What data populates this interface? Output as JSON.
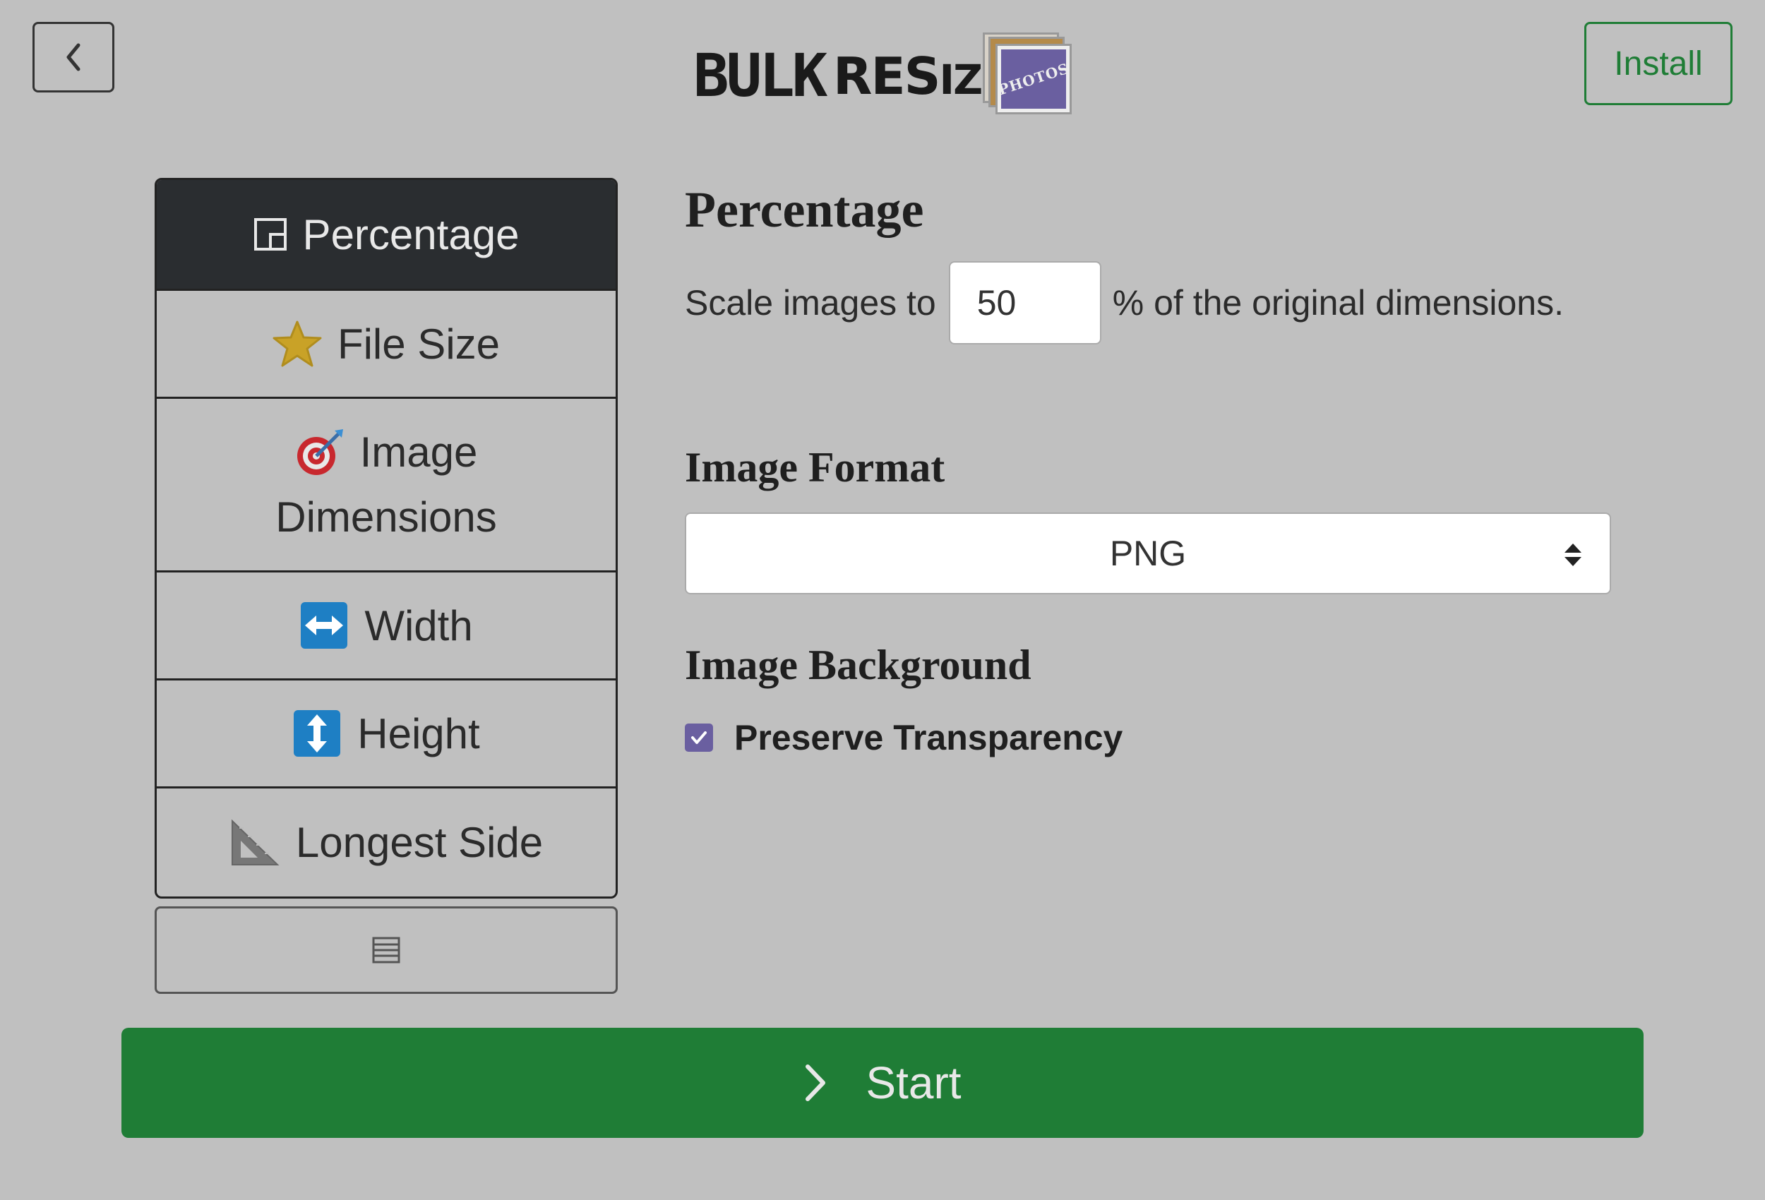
{
  "header": {
    "back_icon": "chevron-left-icon",
    "logo": {
      "part1": "BULK",
      "part2a": "RES",
      "part2b": "IZE",
      "photos": "PHOTOS"
    },
    "install_label": "Install"
  },
  "sidebar": {
    "items": [
      {
        "label": "Percentage",
        "icon": "percentage-icon",
        "active": true
      },
      {
        "label": "File Size",
        "icon": "star-icon"
      },
      {
        "label": "Image",
        "label2": "Dimensions",
        "icon": "target-icon"
      },
      {
        "label": "Width",
        "icon": "left-right-arrow-icon"
      },
      {
        "label": "Height",
        "icon": "up-down-arrow-icon"
      },
      {
        "label": "Longest Side",
        "icon": "triangle-ruler-icon"
      }
    ],
    "more_icon": "list-icon"
  },
  "main": {
    "percentage_title": "Percentage",
    "scale_prefix": "Scale images to",
    "scale_value": "50",
    "scale_suffix": "% of the original dimensions.",
    "format_title": "Image Format",
    "format_value": "PNG",
    "background_title": "Image Background",
    "preserve_label": "Preserve Transparency",
    "preserve_checked": true
  },
  "start_label": "Start",
  "colors": {
    "accent_green": "#1f7d36",
    "checkbox_purple": "#6a5fa0",
    "active_dark": "#2a2d30",
    "background": "#c0c0c0"
  }
}
